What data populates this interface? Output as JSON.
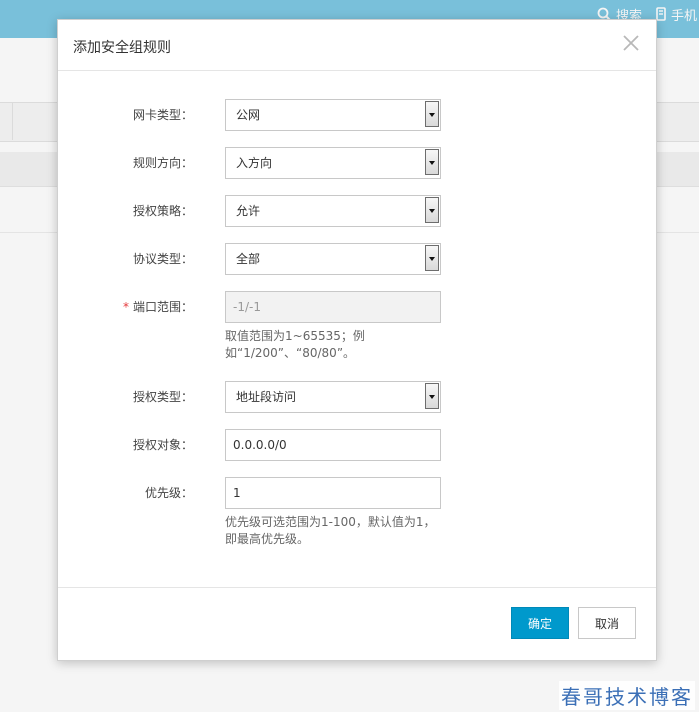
{
  "background": {
    "top_links": [
      {
        "icon": "search-icon",
        "label": "搜索"
      },
      {
        "icon": "phone-icon",
        "label": "手机"
      }
    ]
  },
  "dialog": {
    "title": "添加安全组规则",
    "fields": {
      "nic_type": {
        "label": "网卡类型：",
        "value": "公网"
      },
      "direction": {
        "label": "规则方向：",
        "value": "入方向"
      },
      "policy": {
        "label": "授权策略：",
        "value": "允许"
      },
      "protocol": {
        "label": "协议类型：",
        "value": "全部"
      },
      "port_range": {
        "required_mark": "*",
        "label": "端口范围：",
        "value": "-1/-1",
        "help": "取值范围为1~65535；例如“1/200”、“80/80”。"
      },
      "auth_type": {
        "label": "授权类型：",
        "value": "地址段访问"
      },
      "auth_object": {
        "label": "授权对象：",
        "value": "0.0.0.0/0"
      },
      "priority": {
        "label": "优先级：",
        "value": "1",
        "help": "优先级可选范围为1-100，默认值为1，即最高优先级。"
      }
    },
    "buttons": {
      "ok": "确定",
      "cancel": "取消"
    }
  },
  "watermark": "春哥技术博客",
  "colors": {
    "primary": "#0099cc",
    "required": "#e4393c",
    "topbar": "#7ec8e3"
  }
}
